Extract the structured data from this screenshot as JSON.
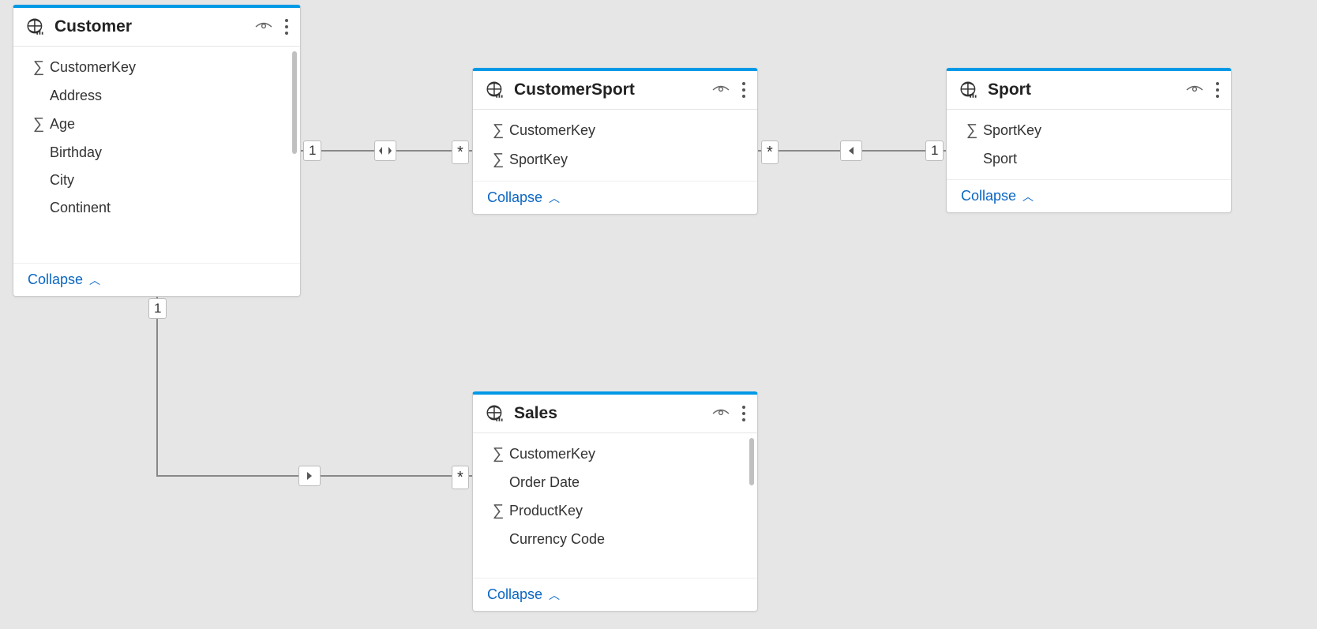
{
  "collapse_label": "Collapse",
  "tables": {
    "customer": {
      "title": "Customer",
      "fields": [
        {
          "name": "CustomerKey",
          "sigma": true
        },
        {
          "name": "Address",
          "sigma": false
        },
        {
          "name": "Age",
          "sigma": true
        },
        {
          "name": "Birthday",
          "sigma": false
        },
        {
          "name": "City",
          "sigma": false
        },
        {
          "name": "Continent",
          "sigma": false
        }
      ]
    },
    "customerSport": {
      "title": "CustomerSport",
      "fields": [
        {
          "name": "CustomerKey",
          "sigma": true
        },
        {
          "name": "SportKey",
          "sigma": true
        }
      ]
    },
    "sport": {
      "title": "Sport",
      "fields": [
        {
          "name": "SportKey",
          "sigma": true
        },
        {
          "name": "Sport",
          "sigma": false
        }
      ]
    },
    "sales": {
      "title": "Sales",
      "fields": [
        {
          "name": "CustomerKey",
          "sigma": true
        },
        {
          "name": "Order Date",
          "sigma": false
        },
        {
          "name": "ProductKey",
          "sigma": true
        },
        {
          "name": "Currency Code",
          "sigma": false
        }
      ]
    }
  },
  "relationships": {
    "customer_customerSport": {
      "left": "1",
      "right": "*",
      "filter": "both"
    },
    "customerSport_sport": {
      "left": "*",
      "right": "1",
      "filter": "single-left"
    },
    "customer_sales": {
      "top": "1",
      "bottom": "*",
      "filter": "single-right"
    }
  }
}
